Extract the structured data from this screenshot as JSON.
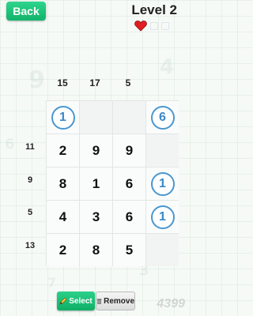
{
  "header": {
    "back_label": "Back",
    "level_label": "Level 2",
    "lives": {
      "filled": 1,
      "empty": 2
    }
  },
  "puzzle": {
    "column_clues": [
      "15",
      "17",
      "5"
    ],
    "row_clues": [
      "11",
      "9",
      "5",
      "13"
    ],
    "top_circles": [
      "1",
      "6"
    ],
    "grid": [
      [
        "2",
        "9",
        "9",
        ""
      ],
      [
        "8",
        "1",
        "6",
        "1"
      ],
      [
        "4",
        "3",
        "6",
        "1"
      ],
      [
        "2",
        "8",
        "5",
        ""
      ]
    ]
  },
  "toolbar": {
    "select_label": "Select",
    "remove_label": "Remove"
  },
  "colors": {
    "accent_green": "#12b36b",
    "circle_blue": "#4a97d0",
    "heart_red": "#e01e24"
  },
  "watermark": "4399"
}
